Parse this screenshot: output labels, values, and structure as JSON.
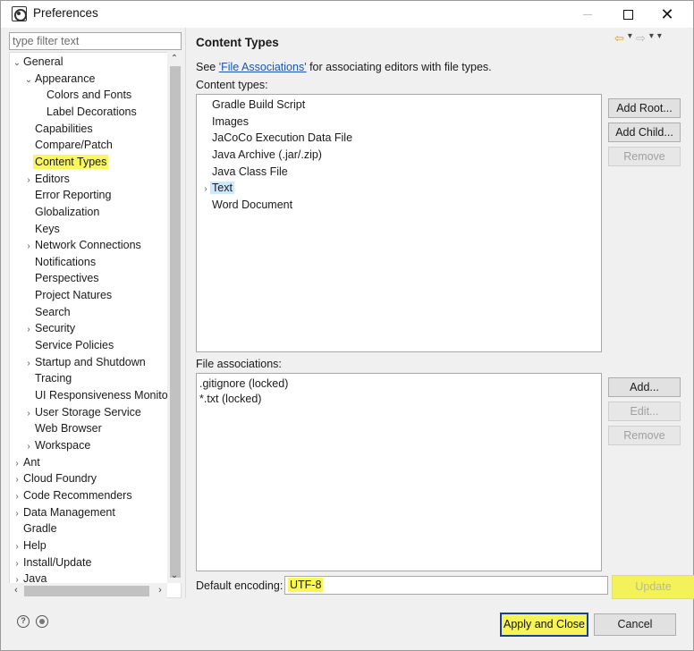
{
  "window": {
    "title": "Preferences"
  },
  "filter": {
    "placeholder": "type filter text"
  },
  "tree": [
    {
      "label": "General",
      "level": 0,
      "toggle": "expanded"
    },
    {
      "label": "Appearance",
      "level": 1,
      "toggle": "expanded"
    },
    {
      "label": "Colors and Fonts",
      "level": 2,
      "toggle": "none"
    },
    {
      "label": "Label Decorations",
      "level": 2,
      "toggle": "none"
    },
    {
      "label": "Capabilities",
      "level": 1,
      "toggle": "none"
    },
    {
      "label": "Compare/Patch",
      "level": 1,
      "toggle": "none"
    },
    {
      "label": "Content Types",
      "level": 1,
      "toggle": "none",
      "selected": true
    },
    {
      "label": "Editors",
      "level": 1,
      "toggle": "collapsed"
    },
    {
      "label": "Error Reporting",
      "level": 1,
      "toggle": "none"
    },
    {
      "label": "Globalization",
      "level": 1,
      "toggle": "none"
    },
    {
      "label": "Keys",
      "level": 1,
      "toggle": "none"
    },
    {
      "label": "Network Connections",
      "level": 1,
      "toggle": "collapsed"
    },
    {
      "label": "Notifications",
      "level": 1,
      "toggle": "none"
    },
    {
      "label": "Perspectives",
      "level": 1,
      "toggle": "none"
    },
    {
      "label": "Project Natures",
      "level": 1,
      "toggle": "none"
    },
    {
      "label": "Search",
      "level": 1,
      "toggle": "none"
    },
    {
      "label": "Security",
      "level": 1,
      "toggle": "collapsed"
    },
    {
      "label": "Service Policies",
      "level": 1,
      "toggle": "none"
    },
    {
      "label": "Startup and Shutdown",
      "level": 1,
      "toggle": "collapsed"
    },
    {
      "label": "Tracing",
      "level": 1,
      "toggle": "none"
    },
    {
      "label": "UI Responsiveness Monitor",
      "level": 1,
      "toggle": "none"
    },
    {
      "label": "User Storage Service",
      "level": 1,
      "toggle": "collapsed"
    },
    {
      "label": "Web Browser",
      "level": 1,
      "toggle": "none"
    },
    {
      "label": "Workspace",
      "level": 1,
      "toggle": "collapsed"
    },
    {
      "label": "Ant",
      "level": 0,
      "toggle": "collapsed"
    },
    {
      "label": "Cloud Foundry",
      "level": 0,
      "toggle": "collapsed"
    },
    {
      "label": "Code Recommenders",
      "level": 0,
      "toggle": "collapsed"
    },
    {
      "label": "Data Management",
      "level": 0,
      "toggle": "collapsed"
    },
    {
      "label": "Gradle",
      "level": 0,
      "toggle": "none"
    },
    {
      "label": "Help",
      "level": 0,
      "toggle": "collapsed"
    },
    {
      "label": "Install/Update",
      "level": 0,
      "toggle": "collapsed"
    },
    {
      "label": "Java",
      "level": 0,
      "toggle": "collapsed"
    }
  ],
  "page": {
    "title": "Content Types",
    "see_prefix": "See ",
    "see_link": "'File Associations'",
    "see_suffix": " for associating editors with file types.",
    "content_types_label": "Content types:",
    "content_types": [
      {
        "label": "Gradle Build Script",
        "toggle": "none"
      },
      {
        "label": "Images",
        "toggle": "none"
      },
      {
        "label": "JaCoCo Execution Data File",
        "toggle": "none"
      },
      {
        "label": "Java Archive (.jar/.zip)",
        "toggle": "none"
      },
      {
        "label": "Java Class File",
        "toggle": "none"
      },
      {
        "label": "Text",
        "toggle": "collapsed",
        "selected": true
      },
      {
        "label": "Word Document",
        "toggle": "none"
      }
    ],
    "file_assoc_label": "File associations:",
    "file_associations": [
      ".gitignore (locked)",
      "*.txt (locked)"
    ],
    "encoding_label": "Default encoding:",
    "encoding_value": "UTF-8"
  },
  "buttons": {
    "add_root": "Add Root...",
    "add_child": "Add Child...",
    "remove_type": "Remove",
    "add_assoc": "Add...",
    "edit_assoc": "Edit...",
    "remove_assoc": "Remove",
    "update": "Update",
    "apply_close": "Apply and Close",
    "cancel": "Cancel"
  },
  "glyphs": {
    "expanded": "⌄",
    "collapsed": "›",
    "close": "✕",
    "up": "⌃",
    "down": "⌄",
    "left": "‹",
    "right": "›",
    "nav_back": "⇦",
    "nav_fwd": "⇨",
    "menu": "▾",
    "help": "?"
  },
  "colors": {
    "highlight": "#f9f75a",
    "selection": "#cce8ff",
    "link": "#1a56b3",
    "focus_border": "#1b3f8f"
  }
}
